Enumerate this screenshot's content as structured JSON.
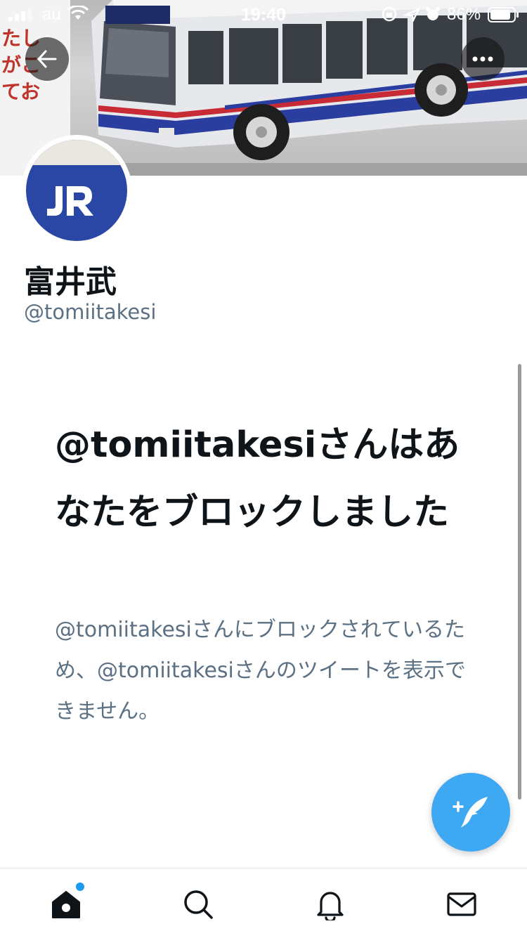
{
  "status_bar": {
    "carrier": "au",
    "time": "19:40",
    "battery_percent": "86%",
    "signal_bars": 3,
    "icons": [
      "orientation-lock-icon",
      "location-arrow-icon",
      "alarm-icon"
    ]
  },
  "banner": {
    "side_text": "たし\nがこ\nてお"
  },
  "profile": {
    "display_name": "富井武",
    "handle": "@tomiitakesi"
  },
  "blocked": {
    "title": "@tomiitakesiさんはあなたをブロックしました",
    "description": "@tomiitakesiさんにブロックされているため、@tomiitakesiさんのツイートを表示できません。"
  },
  "bottom_nav": {
    "items": [
      {
        "name": "home",
        "icon": "home-icon",
        "active": true,
        "has_badge": true
      },
      {
        "name": "search",
        "icon": "search-icon"
      },
      {
        "name": "notifications",
        "icon": "bell-icon"
      },
      {
        "name": "messages",
        "icon": "mail-icon"
      }
    ]
  },
  "colors": {
    "accent": "#1d9bf0",
    "text_primary": "#0f1419",
    "text_secondary": "#5b7083",
    "avatar_blue": "#2a47a6"
  }
}
